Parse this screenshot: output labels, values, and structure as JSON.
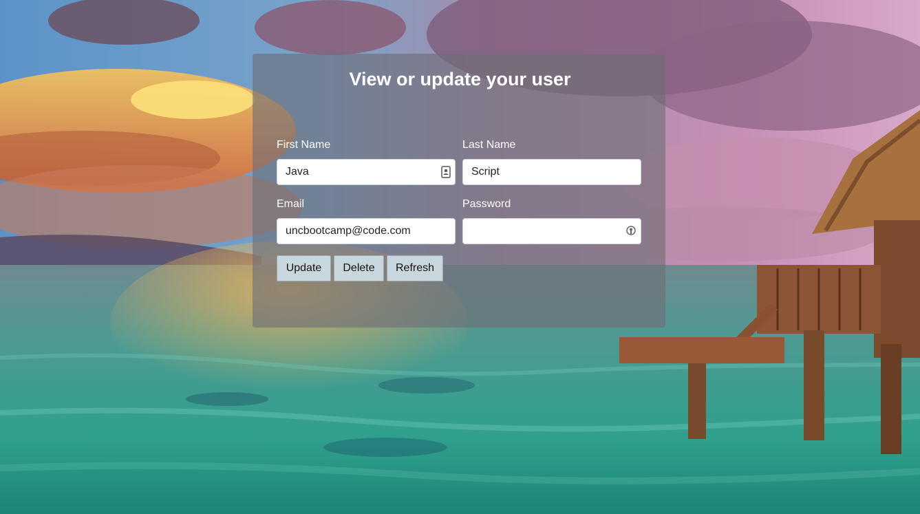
{
  "form": {
    "title": "View or update your user",
    "first_name": {
      "label": "First Name",
      "value": "Java"
    },
    "last_name": {
      "label": "Last Name",
      "value": "Script"
    },
    "email": {
      "label": "Email",
      "value": "uncbootcamp@code.com"
    },
    "password": {
      "label": "Password",
      "value": ""
    }
  },
  "buttons": {
    "update": "Update",
    "delete": "Delete",
    "refresh": "Refresh"
  },
  "icons": {
    "first_name_field": "contact-card-icon",
    "password_field": "key-icon"
  },
  "colors": {
    "card_overlay": "#6e6e78",
    "button_bg": "#c7d7dd",
    "text_light": "#ffffff"
  }
}
